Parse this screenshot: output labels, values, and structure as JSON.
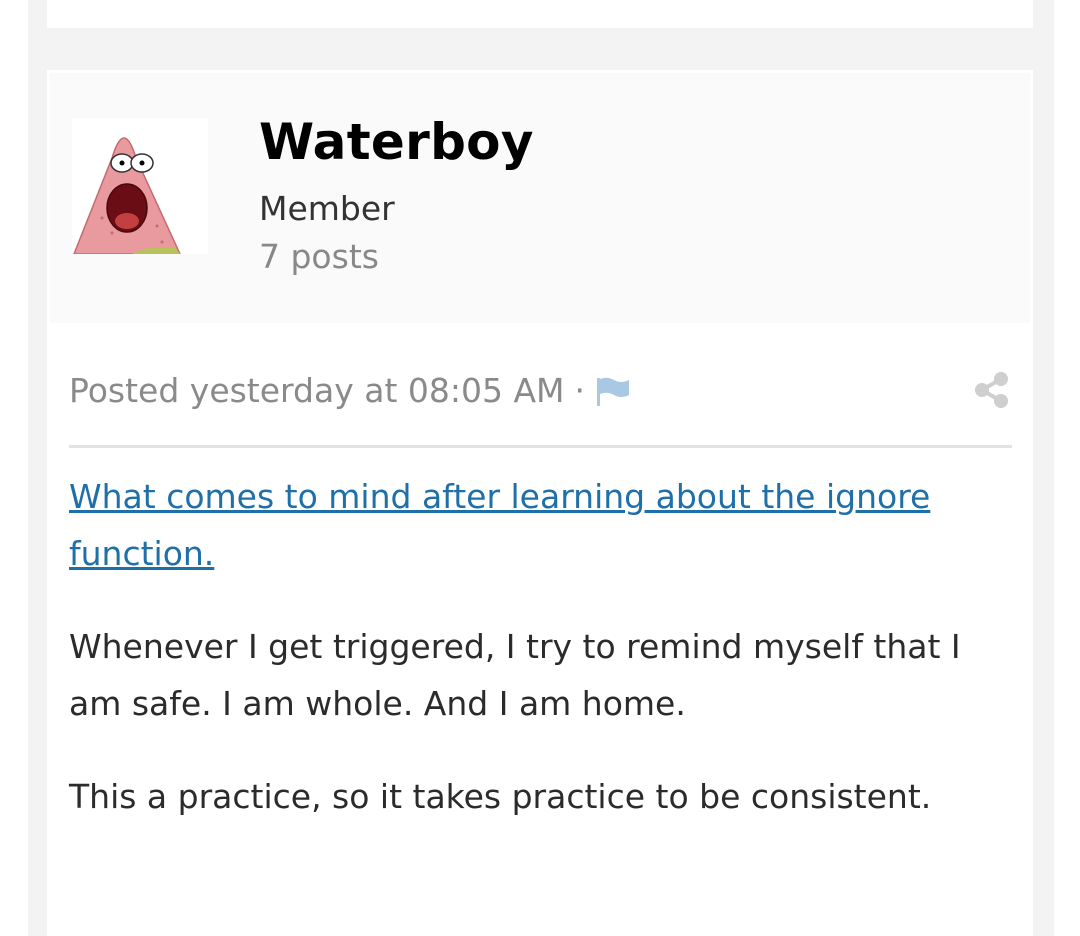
{
  "author": {
    "name": "Waterboy",
    "title": "Member",
    "posts": "7 posts",
    "avatar_icon": "patrick-star-avatar"
  },
  "meta": {
    "posted": "Posted yesterday at 08:05 AM",
    "separator": "·",
    "flag_icon": "flag-icon",
    "share_icon": "share-icon"
  },
  "post": {
    "link_text": "What comes to mind after learning about the ignore function.",
    "paragraph_1": "Whenever I get triggered, I try to remind myself that I am safe. I am whole. And I am home.",
    "paragraph_2": "This a practice, so it takes practice to be consistent."
  },
  "colors": {
    "link": "#1f6fa8",
    "flag": "#a9c8e4",
    "muted": "#8a8a8a"
  }
}
